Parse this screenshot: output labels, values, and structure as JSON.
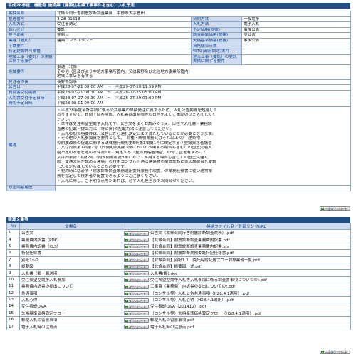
{
  "header": {
    "title": "平成28年度　機動部 施設課（建築住宅課工事事件を含む）入札予定"
  },
  "info_rows": [
    {
      "l1": "案件名称",
      "v1": "北條合同庁舎耐震診断調査業務　中野市大字豊田",
      "wide": true
    },
    {
      "l1": "整理番号",
      "v1": "3-28-01518",
      "l2": "契約方式",
      "v2": "一般競争"
    },
    {
      "l1": "入札方式",
      "v1": "受注者決定",
      "l2": "入札方法",
      "v2": "電子入札"
    },
    {
      "l1": "執行区分",
      "v1": "委託",
      "l2": "予定価格(税抜)",
      "v2": "事後公表"
    },
    {
      "l1": "担当部署",
      "v1": "非開示",
      "l2": "調査基準価格(税抜)",
      "v2": "非公表"
    },
    {
      "l1": "業種（種別）",
      "v1": "建築コンサルタント",
      "l2": "失格基準価格(税抜)",
      "v2": "事後公表"
    },
    {
      "l1": "下請要件",
      "v1": "",
      "l2": "資格総合点数",
      "v2": ""
    },
    {
      "l1": "特定建設許可業種",
      "v1": "",
      "l2": "WTO(政府調達)案件",
      "v2": ""
    },
    {
      "l1": "地域工事（委託）の実績に関する要件",
      "v1": "",
      "l2": "地元工事（委託）の受託実績に関する要件",
      "v2": "",
      "tall": true
    }
  ],
  "location": {
    "label": "地域要件",
    "lines": [
      "東通　北條",
      "その他（区及びより中地方事業所管内、又は長野及び北信地方事業所管内）",
      "地域に本店を有する"
    ]
  },
  "date_rows": [
    {
      "l": "発注者の長",
      "v": "長野県知事"
    },
    {
      "l": "公告日",
      "v": "平成28-07-21 08:00 AM　～　平成29-07-20 11:59 PM"
    },
    {
      "l": "質問書受付期間",
      "v": "平成28-07-21 08:30 AM　～　平成28-07-25 05:00 PM"
    },
    {
      "l": "入札書受付予定日時",
      "v": "平成28-07-27 08:30 AM　～　平成28-07-29 01:00 PM"
    },
    {
      "l": "開札予定日時",
      "v": "平成28-08-01 09:00 AM"
    }
  ],
  "remarks": {
    "label": "備考",
    "lines": [
      "・平成28年度会計手続に係る公共事業の早期発注に資するため、入札公告期間を短縮して",
      "おりますので、質問・回答期間、入札書提出期限等の日程をよくご確認のうえ入札してく",
      "ださい。",
      "・本件は受注希望型競争入札です。公告文をよくお読みのうえ、日程や入札書・業務調",
      "査書の記載・提出方法（等に関)の記載方法に注意してください。",
      "・入札参加資格要件は、公告日から落札決定日まで満たしていることが必要となります。",
      "・その他の入札参加資格要件として、「同種・規模業務又はそれ以上の）「建築物",
      "の耐震改修の促進に関する法律施行規則第5条第1項第1号に規定する「登録資格者講習",
      "」又は同条第1項第2号（同規則附則第3条において準用する場合も含む）の国土交通大",
      "臣が定める者を定める件第1号に規定する「登録資格者講習」の修了証を有すること",
      "又は同条第1項第2号（同規則附則第3条において準用する場合も含む）の国土交通大",
      "国土交通大臣が認める建築」の技術コンサルト適法建築物の耐震診断に係る講習会を受講",
      "した者が所属していることが必要です。",
      "・契約時には必ず「耐震診断調査業務適用委託業務手順書」の業務仕様書に従い通常業",
      "務を指定して技術者が配置できるようにご注意ください。",
      "・入札に際し、ご不明な点等があれば、必ず入札担当までお問合せください。"
    ]
  },
  "revision": {
    "label": "修正内容履歴",
    "value": ""
  },
  "bulk_button": "一括ダウンロード",
  "docs": {
    "section_title": "積算文書等",
    "headers": {
      "no": "No",
      "name": "文書名",
      "file": "格納ファイル名／外部リンクURL"
    },
    "button_label": "ダウンロード",
    "rows": [
      {
        "no": "1",
        "name": "公告文",
        "file": "公告文（北條合同庁舎耐震診断調査業務）.pdf"
      },
      {
        "no": "4",
        "name": "業務費内訳書（PDF）",
        "file": "【北條合同】耐震診断調査業務費内訳書.pdf"
      },
      {
        "no": "5",
        "name": "業務費内訳書（XLS）",
        "file": "【北條合同】耐震診断調査業務費内訳書.xls"
      },
      {
        "no": "6",
        "name": "特記仕様書",
        "file": "【北條合同】耐震診断業務委託特記仕様書.pdf"
      },
      {
        "no": "7",
        "name": "別紙1～2",
        "file": "【北條合同】別紙1,2　委託契約変更プロー対象業務一覧.pdf"
      },
      {
        "no": "8",
        "name": "概要図",
        "file": "【北條合同】概要図一式.pdf"
      },
      {
        "no": "9",
        "name": "入札書（郵・郵送用）",
        "file": "入札書(郵).doc"
      },
      {
        "no": "10",
        "name": "受注希望型競争入札参加",
        "file": "受注希望型競争入札等入札参加に係る調査書事項についてのt.pdf"
      },
      {
        "no": "11",
        "name": "業務費内訳書の提出について",
        "file": "工事費（業務費）内訳書の提出についてのt.pdf"
      },
      {
        "no": "12",
        "name": "共通事項",
        "file": "（コンサル等）入札公告共通事項（H28.4.1適用）.pdf"
      },
      {
        "no": "13",
        "name": "入札心得",
        "file": "（コンサル等）入札心得（H28.4.1適用）.pdf"
      },
      {
        "no": "14",
        "name": "受注者説Q&A",
        "file": "受注者説Q&A（201412）.pdf"
      },
      {
        "no": "15",
        "name": "失格基準価格算定フロー",
        "file": "（コンサル等）失格基準価格算定フロー（H28.4.1適用）.pdf"
      },
      {
        "no": "16",
        "name": "郵便入札の留意事項",
        "file": "郵便入札の留意事項.pdf"
      },
      {
        "no": "17",
        "name": "電子入札時の注意点",
        "file": "電子入札時の注意点.pdf"
      }
    ]
  }
}
